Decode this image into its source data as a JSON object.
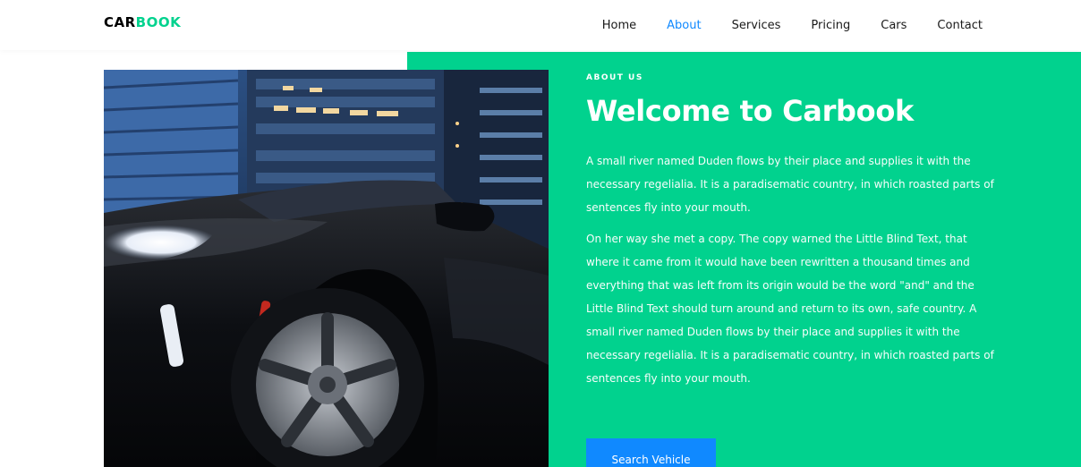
{
  "brand": {
    "part1": "CAR",
    "part2": "BOOK"
  },
  "nav": {
    "items": [
      {
        "label": "Home",
        "active": false
      },
      {
        "label": "About",
        "active": true
      },
      {
        "label": "Services",
        "active": false
      },
      {
        "label": "Pricing",
        "active": false
      },
      {
        "label": "Cars",
        "active": false
      },
      {
        "label": "Contact",
        "active": false
      }
    ]
  },
  "about": {
    "eyebrow": "ABOUT US",
    "title": "Welcome to Carbook",
    "paragraph1": "A small river named Duden flows by their place and supplies it with the necessary regelialia. It is a paradisematic country, in which roasted parts of sentences fly into your mouth.",
    "paragraph2": "On her way she met a copy. The copy warned the Little Blind Text, that where it came from it would have been rewritten a thousand times and everything that was left from its origin would be the word \"and\" and the Little Blind Text should turn around and return to its own, safe country. A small river named Duden flows by their place and supplies it with the necessary regelialia. It is a paradisematic country, in which roasted parts of sentences fly into your mouth.",
    "button_label": "Search Vehicle"
  },
  "colors": {
    "accent_green": "#01d28e",
    "accent_blue": "#1089ff"
  }
}
